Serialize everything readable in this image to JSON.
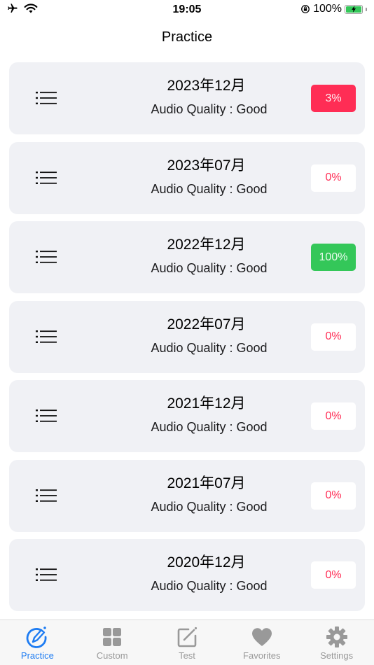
{
  "status_bar": {
    "time": "19:05",
    "battery_percent": "100%",
    "icons": [
      "airplane-icon",
      "wifi-icon",
      "orientation-lock-icon",
      "battery-charging-icon"
    ]
  },
  "header": {
    "title": "Practice"
  },
  "items": [
    {
      "title": "2023年12月",
      "subtitle": "Audio Quality : Good",
      "progress": "3%",
      "state": "partial"
    },
    {
      "title": "2023年07月",
      "subtitle": "Audio Quality : Good",
      "progress": "0%",
      "state": "zero"
    },
    {
      "title": "2022年12月",
      "subtitle": "Audio Quality : Good",
      "progress": "100%",
      "state": "done"
    },
    {
      "title": "2022年07月",
      "subtitle": "Audio Quality : Good",
      "progress": "0%",
      "state": "zero"
    },
    {
      "title": "2021年12月",
      "subtitle": "Audio Quality : Good",
      "progress": "0%",
      "state": "zero"
    },
    {
      "title": "2021年07月",
      "subtitle": "Audio Quality : Good",
      "progress": "0%",
      "state": "zero"
    },
    {
      "title": "2020年12月",
      "subtitle": "Audio Quality : Good",
      "progress": "0%",
      "state": "zero"
    }
  ],
  "colors": {
    "accent": "#1e7cf2",
    "progress_partial": "#ff2d55",
    "progress_done": "#34c759",
    "card_bg": "#f0f1f5"
  },
  "tabs": [
    {
      "label": "Practice",
      "icon": "practice-pen-circle-icon",
      "active": true
    },
    {
      "label": "Custom",
      "icon": "grid-icon",
      "active": false
    },
    {
      "label": "Test",
      "icon": "edit-square-icon",
      "active": false
    },
    {
      "label": "Favorites",
      "icon": "heart-icon",
      "active": false
    },
    {
      "label": "Settings",
      "icon": "gear-icon",
      "active": false
    }
  ]
}
